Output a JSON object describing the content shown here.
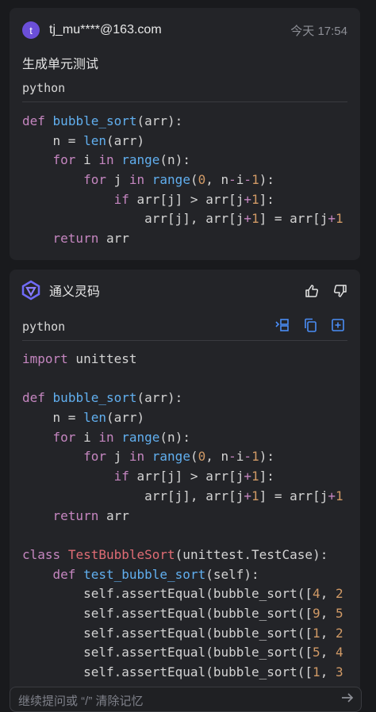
{
  "user_message": {
    "avatar_letter": "t",
    "username": "tj_mu****@163.com",
    "timestamp": "今天 17:54",
    "text": "生成单元测试",
    "code_language": "python",
    "code_lines": [
      "def bubble_sort(arr):",
      "    n = len(arr)",
      "    for i in range(n):",
      "        for j in range(0, n-i-1):",
      "            if arr[j] > arr[j+1]:",
      "                arr[j], arr[j+1] = arr[j+1",
      "    return arr"
    ]
  },
  "ai_message": {
    "name": "通义灵码",
    "logo_icon": "tongyi-lingma-logo",
    "code_language": "python",
    "actions": [
      "insert-icon",
      "copy-icon",
      "new-file-icon"
    ],
    "feedback": [
      "thumbs-up-icon",
      "thumbs-down-icon"
    ],
    "code_lines": [
      "import unittest",
      "",
      "def bubble_sort(arr):",
      "    n = len(arr)",
      "    for i in range(n):",
      "        for j in range(0, n-i-1):",
      "            if arr[j] > arr[j+1]:",
      "                arr[j], arr[j+1] = arr[j+1",
      "    return arr",
      "",
      "class TestBubbleSort(unittest.TestCase):",
      "    def test_bubble_sort(self):",
      "        self.assertEqual(bubble_sort([4, 2",
      "        self.assertEqual(bubble_sort([9, 5",
      "        self.assertEqual(bubble_sort([1, 2",
      "        self.assertEqual(bubble_sort([5, 4",
      "        self.assertEqual(bubble_sort([1, 3"
    ]
  },
  "input": {
    "placeholder": "继续提问或 “/” 清除记忆",
    "send_icon": "send-arrow-icon"
  },
  "colors": {
    "background": "#191a1d",
    "card": "#232428",
    "accent": "#4a8df6",
    "keyword": "#c586c0",
    "function": "#61afef",
    "number": "#d19a66",
    "class_name": "#e06c75"
  }
}
